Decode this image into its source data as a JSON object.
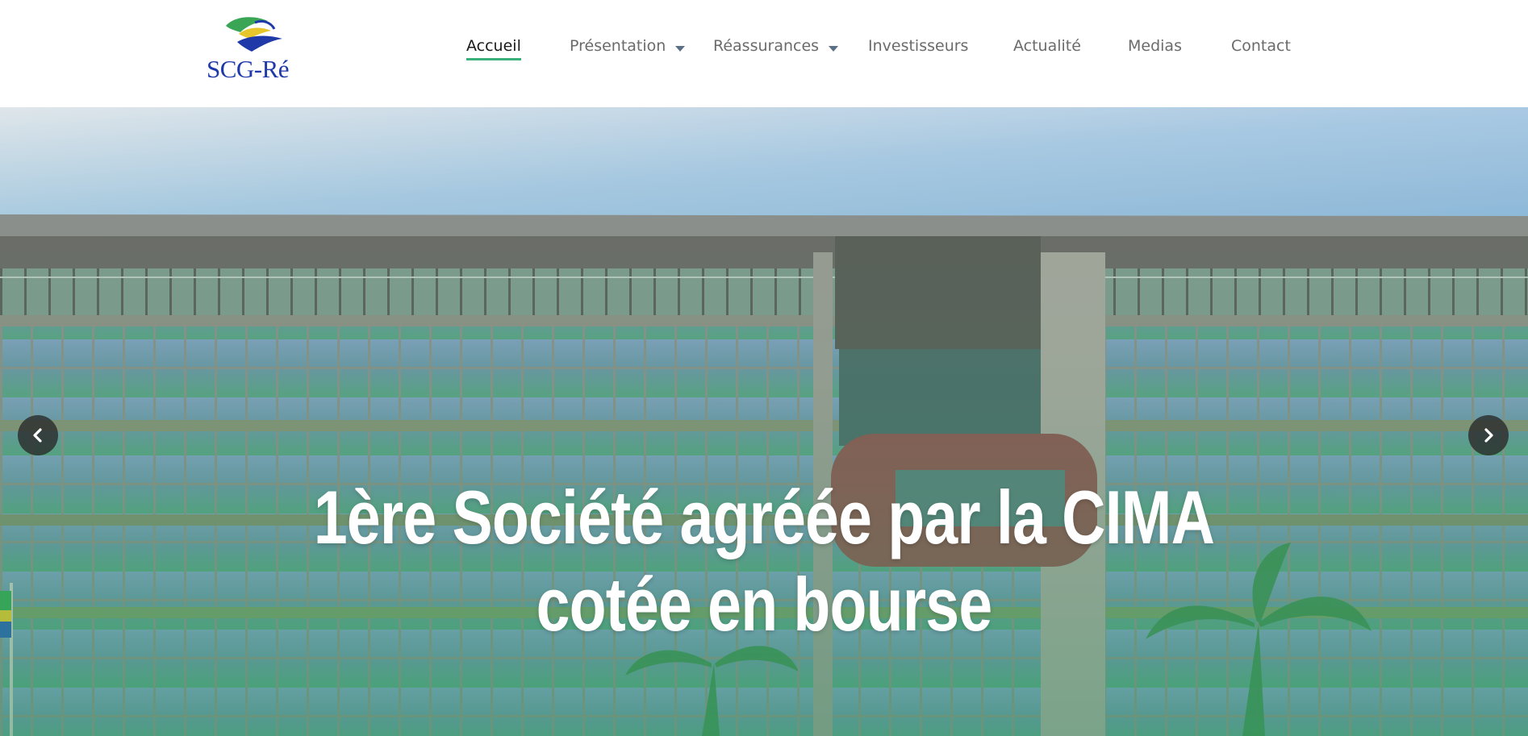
{
  "brand": {
    "logo_text": "SCG-Ré",
    "colors": {
      "blue": "#1f3aa8",
      "green": "#3bb07a",
      "yellow": "#e6c62a"
    }
  },
  "nav": {
    "items": [
      {
        "label": "Accueil",
        "active": true,
        "dropdown": false
      },
      {
        "label": "Présentation",
        "active": false,
        "dropdown": true
      },
      {
        "label": "Réassurances",
        "active": false,
        "dropdown": true
      },
      {
        "label": "Investisseurs",
        "active": false,
        "dropdown": false
      },
      {
        "label": "Actualité",
        "active": false,
        "dropdown": false
      },
      {
        "label": "Medias",
        "active": false,
        "dropdown": false
      },
      {
        "label": "Contact",
        "active": false,
        "dropdown": false
      }
    ],
    "active_underline_color": "#3bb07a"
  },
  "hero": {
    "title_line1": "1ère Société agréée par la CIMA",
    "title_line2": "cotée en bourse",
    "prev_icon": "chevron-left-icon",
    "next_icon": "chevron-right-icon"
  }
}
